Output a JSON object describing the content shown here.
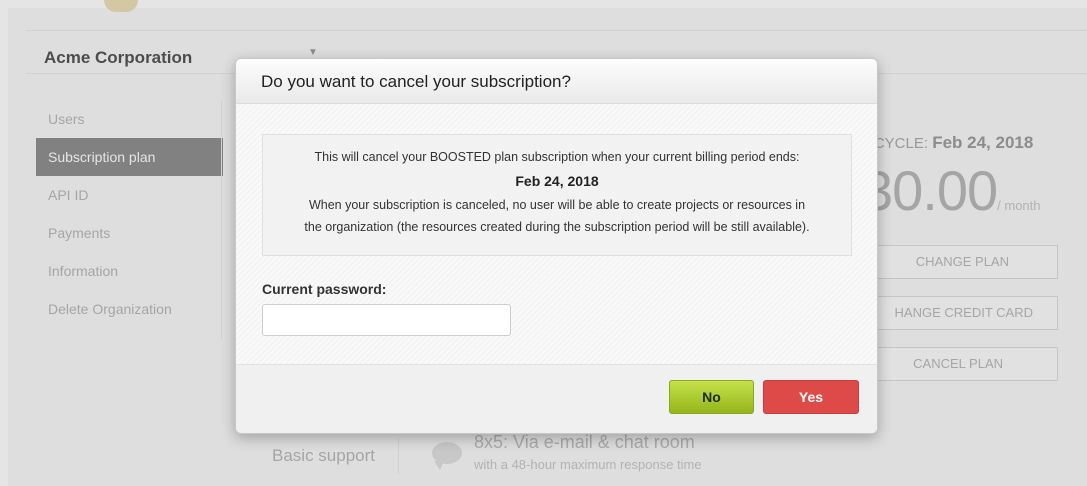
{
  "organization": {
    "name": "Acme Corporation"
  },
  "sidebar": {
    "items": [
      {
        "label": "Users"
      },
      {
        "label": "Subscription plan",
        "active": true
      },
      {
        "label": "API ID"
      },
      {
        "label": "Payments"
      },
      {
        "label": "Information"
      },
      {
        "label": "Delete Organization"
      }
    ]
  },
  "plan_panel": {
    "billing_cycle_label": "G CYCLE: ",
    "billing_cycle_date": "Feb 24, 2018",
    "price_amount": "30.00",
    "price_period": "/ month",
    "change_plan_label": "CHANGE PLAN",
    "change_card_label": "HANGE CREDIT CARD",
    "cancel_plan_label": "CANCEL PLAN"
  },
  "support": {
    "label": "Basic support",
    "title": "8x5: Via e-mail & chat room",
    "subtitle": "with a 48-hour maximum response time"
  },
  "modal": {
    "title": "Do you want to cancel your subscription?",
    "notice_line1": "This will cancel your BOOSTED plan subscription when your current billing period ends:",
    "notice_date": "Feb 24, 2018",
    "notice_line3": "When your subscription is canceled, no user will be able to create projects or resources in",
    "notice_line4": "the organization (the resources created during the subscription period will be still available).",
    "password_label": "Current password:",
    "password_value": "",
    "no_label": "No",
    "yes_label": "Yes"
  },
  "colors": {
    "no_button": "#a8c72b",
    "yes_button": "#de4a47",
    "active_sidebar": "#7a7a7a"
  }
}
